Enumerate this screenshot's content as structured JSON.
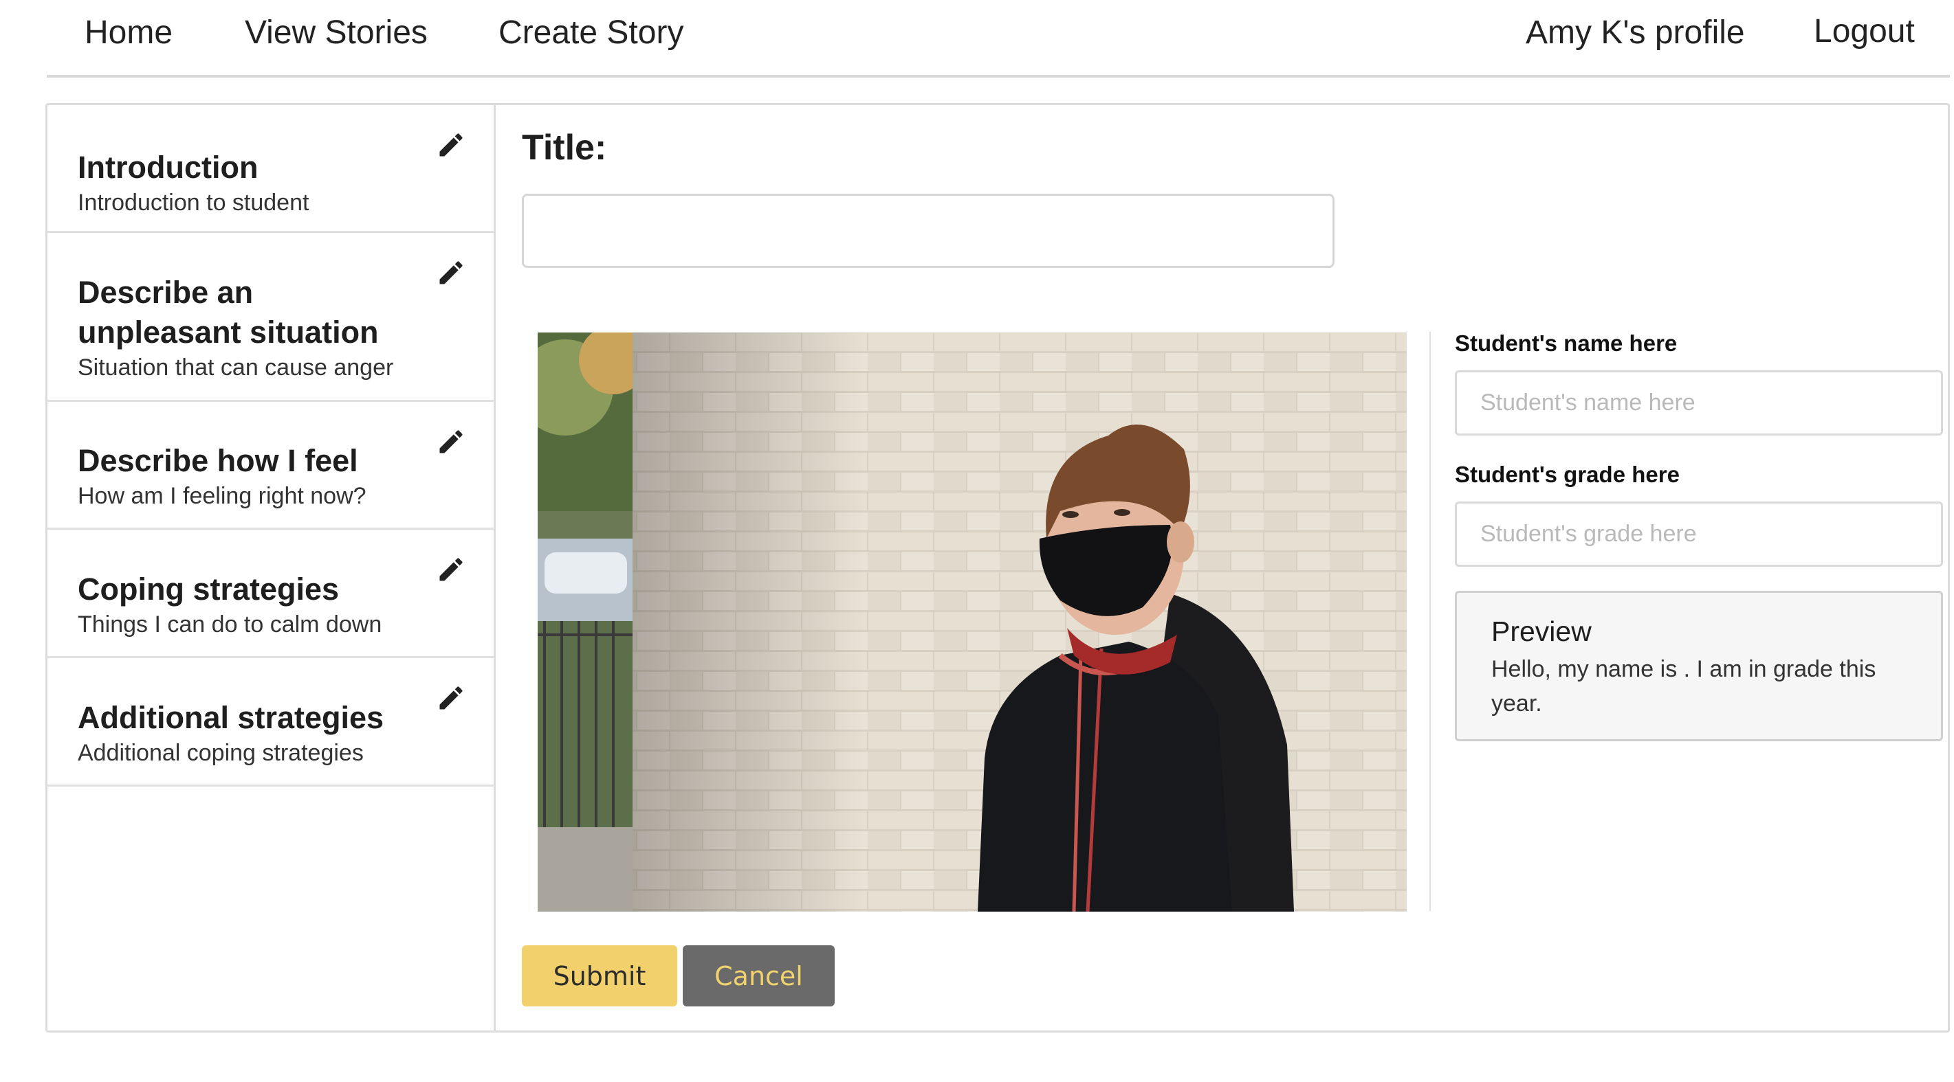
{
  "nav": {
    "home": "Home",
    "view_stories": "View Stories",
    "create_story": "Create Story",
    "profile": "Amy K's profile",
    "logout": "Logout"
  },
  "sidebar": {
    "items": [
      {
        "title": "Introduction",
        "subtitle": "Introduction to student",
        "icon": "pencil-icon"
      },
      {
        "title": "Describe an unpleasant situation",
        "subtitle": "Situation that can cause anger",
        "icon": "pencil-icon"
      },
      {
        "title": "Describe how I feel",
        "subtitle": "How am I feeling right now?",
        "icon": "pencil-icon"
      },
      {
        "title": "Coping strategies",
        "subtitle": "Things I can do to calm down",
        "icon": "pencil-icon"
      },
      {
        "title": "Additional strategies",
        "subtitle": "Additional coping strategies",
        "icon": "pencil-icon"
      }
    ]
  },
  "editor": {
    "title_label": "Title:",
    "title_value": "",
    "name_label": "Student's name here",
    "name_placeholder": "Student's name here",
    "grade_label": "Student's grade here",
    "grade_placeholder": "Student's grade here",
    "preview_title": "Preview",
    "preview_text": "Hello, my name is . I am in grade this year.",
    "submit_label": "Submit",
    "cancel_label": "Cancel"
  },
  "colors": {
    "submit_bg": "#f2d06b",
    "cancel_bg": "#6a6a6a",
    "cancel_text": "#f0d36c"
  }
}
